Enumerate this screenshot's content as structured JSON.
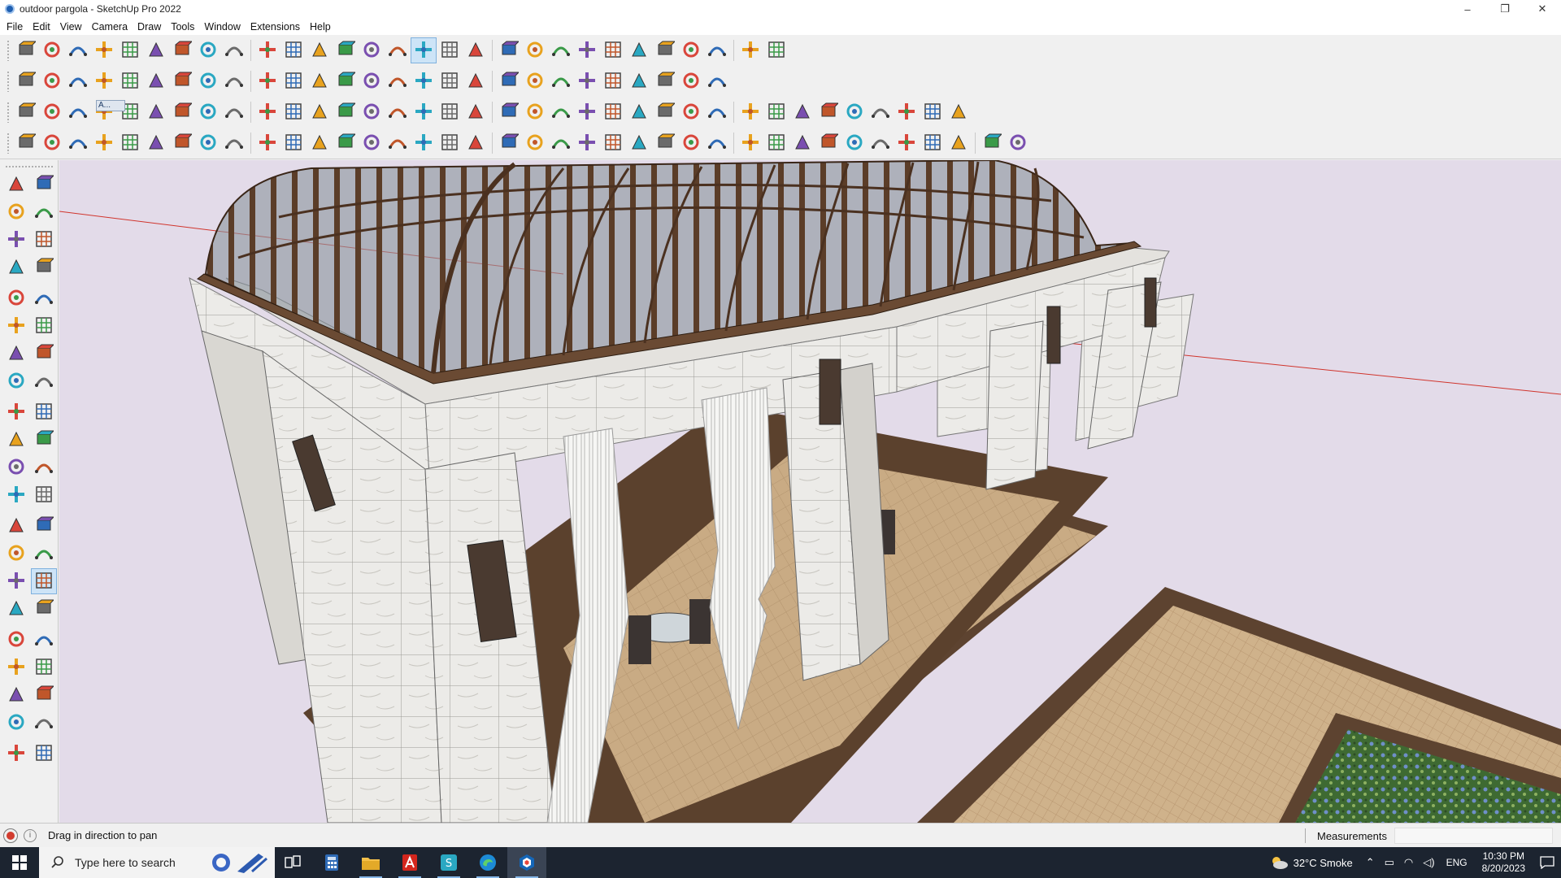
{
  "window": {
    "title": "outdoor pargola - SketchUp Pro 2022",
    "controls": {
      "minimize": "–",
      "restore": "❐",
      "close": "✕"
    }
  },
  "menu": [
    "File",
    "Edit",
    "View",
    "Camera",
    "Draw",
    "Tools",
    "Window",
    "Extensions",
    "Help"
  ],
  "toolbar_icons": {
    "row1": [
      "zoom-extents-icon",
      "select-icon",
      "eraser-icon",
      "line-icon",
      "arc-icon",
      "rectangle-icon",
      "push-pull-icon",
      "follow-me-icon",
      "move-icon",
      "rotate-icon",
      "scale-icon",
      "tape-measure-icon",
      "text-icon",
      "paint-bucket-icon",
      "orbit-icon",
      "pan-icon",
      "zoom-icon",
      "zoom-window-icon",
      "warehouse-icon",
      "extension-warehouse-icon",
      "layout-icon",
      "dynamic-components-icon",
      "profile-icon",
      "sandbox-icon",
      "section-icon",
      "axes-icon",
      "undo-icon",
      "redo-icon",
      "trimble-icon"
    ],
    "row2": [
      "solid-inspector-icon",
      "solid-union-icon",
      "solid-subtract-icon",
      "outer-shell-icon",
      "intersect-icon",
      "trim-icon",
      "split-icon",
      "gear-icon",
      "shape-icon",
      "wall-icon",
      "door-icon",
      "window-icon",
      "roof-icon",
      "house-icon",
      "stair-icon",
      "fence-icon",
      "curve-icon",
      "polygon-icon",
      "circle-icon",
      "ellipse-icon",
      "parallelogram-icon",
      "spline-icon",
      "bezier-icon",
      "weld-icon",
      "measure-icon",
      "weld-edges-icon",
      "paint-icon"
    ],
    "row3": [
      "layer-blue-icon",
      "layer-cyan-icon",
      "layer-yellow-icon",
      "component-icon",
      "flatten-icon",
      "rotate-orange-icon",
      "frame-red-icon",
      "frame-icon",
      "pipe-icon",
      "chain-icon",
      "path-icon",
      "cross-red-icon",
      "cross-green-icon",
      "cross-blue-icon",
      "cone-icon",
      "crown-icon",
      "triangle-icon",
      "loop-icon",
      "loop-red-icon",
      "loop-dark-icon",
      "axis-icon",
      "box-icon",
      "arrow-red-icon",
      "tree-icon",
      "cluster-icon",
      "cluster-red-icon",
      "cube-red-icon",
      "cube-yellow-icon",
      "gear-mix-icon",
      "bridge-icon",
      "grid-orange-icon",
      "grid-yellow-icon",
      "grid-orange2-icon",
      "dots-icon",
      "dots2-icon",
      "dots3-icon"
    ],
    "row4": [
      "curve-dotted-icon",
      "curve-red-icon",
      "car-icon",
      "ruby-icon",
      "loop-outline-icon",
      "loop-outline2-icon",
      "arch-icon",
      "cube-outline-icon",
      "ball-icon",
      "fold-icon",
      "angle-icon",
      "angle2-icon",
      "angle-red-icon",
      "angle-red2-icon",
      "frame-outline-icon",
      "shade-icon",
      "stairs-icon",
      "stairs2-icon",
      "hand-icon",
      "panel-icon",
      "panel2-icon",
      "panel3-icon",
      "line-thin-icon",
      "line-thin2-icon",
      "line-thin3-icon",
      "line-thin4-icon",
      "grid-dark-icon",
      "grid-dark2-icon",
      "grid-dark3-icon",
      "grid-dark4-icon",
      "grid-dark5-icon",
      "grid-dark6-icon",
      "grid-dark7-icon",
      "grid-dark8-icon",
      "grid-dark9-icon",
      "grid-dark10-icon",
      "grid-dark11-icon",
      "cube-white-icon"
    ],
    "row3_label": "A..."
  },
  "left_palette": [
    "select-icon",
    "orbit-icon",
    "paint-bucket-icon",
    "eraser-icon",
    "component-icon",
    "tag-icon",
    "pencil-icon",
    "freehand-icon",
    "rectangle-icon",
    "rotated-rectangle-icon",
    "circle-icon",
    "polygon-icon",
    "arc-icon",
    "pie-icon",
    "three-point-arc-icon",
    "two-point-arc-icon",
    "move-icon",
    "push-pull-icon",
    "rotate-icon",
    "follow-me-icon",
    "scale-icon",
    "offset-icon",
    "tape-measure-icon",
    "dimension-icon",
    "protractor-icon",
    "text-icon",
    "axes-icon",
    "3d-text-icon",
    "orbit-tool-icon",
    "pan-icon",
    "zoom-icon",
    "zoom-window-icon",
    "zoom-extents-icon",
    "previous-view-icon",
    "position-camera-icon",
    "look-around-icon",
    "walk-icon",
    "section-plane-icon",
    "warehouse-icon",
    "extension-warehouse-icon",
    "layers-icon",
    "send-icon"
  ],
  "status": {
    "hint": "Drag in direction to pan",
    "info_icon": "i",
    "measurements_label": "Measurements",
    "measurements_value": ""
  },
  "taskbar": {
    "search_placeholder": "Type here to search",
    "apps": [
      "task-view-icon",
      "calculator-icon",
      "file-explorer-icon",
      "acrobat-icon",
      "app-s-icon",
      "edge-icon",
      "sketchup-icon"
    ],
    "weather": "32°C  Smoke",
    "language": "ENG",
    "time": "10:30 PM",
    "date": "8/20/2023"
  },
  "colors": {
    "viewport_bg": "#e3dbe9",
    "active_button": "#cde4f7",
    "taskbar": "#1c2430",
    "roof_wood": "#6a4a33",
    "stone": "#e9e7e3",
    "floor_tile": "#c8a981",
    "axis_red": "#d0342c"
  }
}
